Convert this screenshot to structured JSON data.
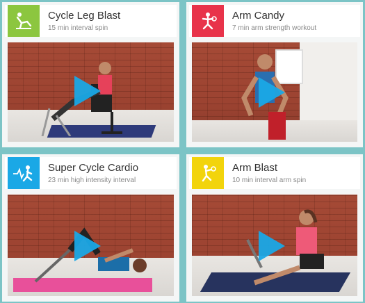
{
  "cards": [
    {
      "title": "Cycle Leg Blast",
      "subtitle": "15 min interval spin",
      "icon": "cyclist-icon",
      "icon_color": "#8cc63f"
    },
    {
      "title": "Arm Candy",
      "subtitle": "7 min arm strength workout",
      "icon": "arm-cycle-icon",
      "icon_color": "#e8334a"
    },
    {
      "title": "Super Cycle Cardio",
      "subtitle": "23 min high intensity interval",
      "icon": "cardio-icon",
      "icon_color": "#1aa8e6"
    },
    {
      "title": "Arm Blast",
      "subtitle": "10 min interval arm spin",
      "icon": "arm-blast-icon",
      "icon_color": "#f2d40c"
    }
  ],
  "colors": {
    "background": "#7cc4c6",
    "play": "#1aa8e6"
  }
}
